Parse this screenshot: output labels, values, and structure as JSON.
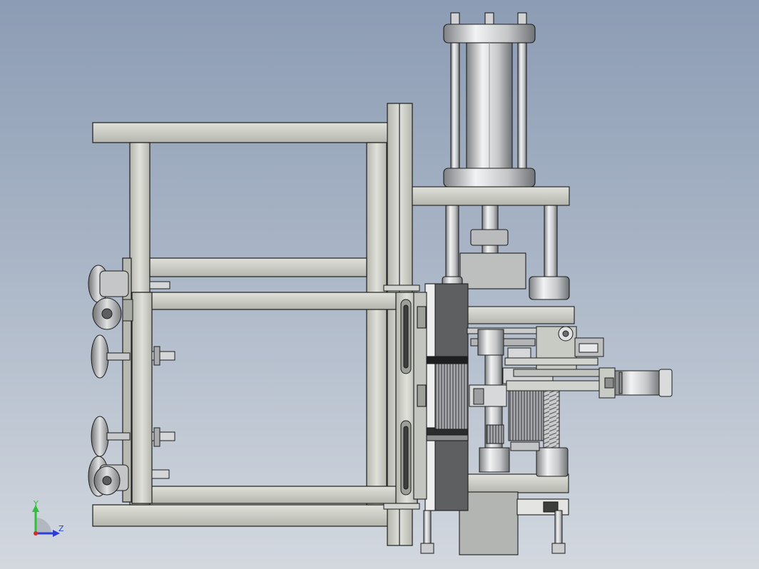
{
  "viewport": {
    "background_top": "#8c9cb4",
    "background_bottom": "#d3d8df"
  },
  "triad": {
    "y_label": "Y",
    "z_label": "Z",
    "y_color": "#2fbf3a",
    "z_color": "#2a3fd6",
    "x_color": "#d42a2a"
  },
  "colors": {
    "frame": "#c9cbc3",
    "frame_dark": "#8e908a",
    "edge": "#1e1e1e",
    "steel": "#d8dadc",
    "steel_dark": "#7d8084",
    "motor": "#e6e7e8",
    "plate": "#5c5e60",
    "wheel": "#b7b9ba"
  }
}
